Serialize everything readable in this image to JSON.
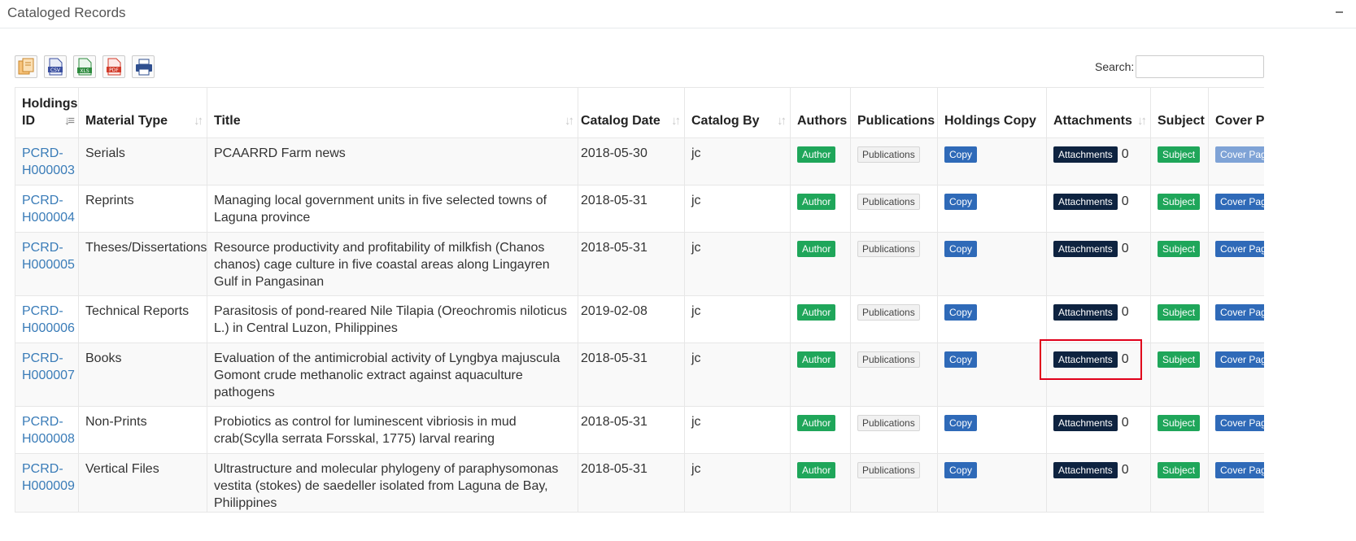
{
  "panel": {
    "title": "Cataloged Records"
  },
  "search": {
    "label": "Search:",
    "value": ""
  },
  "columns": {
    "holdings_id": "Holdings ID",
    "material_type": "Material Type",
    "title": "Title",
    "catalog_date": "Catalog Date",
    "catalog_by": "Catalog By",
    "authors": "Authors",
    "publications": "Publications",
    "holdings_copy": "Holdings Copy",
    "attachments": "Attachments",
    "subject": "Subject",
    "cover_page": "Cover Page"
  },
  "buttons": {
    "author": "Author",
    "publications": "Publications",
    "copy": "Copy",
    "attachments": "Attachments",
    "subject": "Subject",
    "cover_page": "Cover Page"
  },
  "rows": [
    {
      "id": "PCRD-H000003",
      "material_type": "Serials",
      "title": "PCAARRD Farm news",
      "catalog_date": "2018-05-30",
      "catalog_by": "jc",
      "attachments_count": "0"
    },
    {
      "id": "PCRD-H000004",
      "material_type": "Reprints",
      "title": "Managing local government units in five selected towns of Laguna province",
      "catalog_date": "2018-05-31",
      "catalog_by": "jc",
      "attachments_count": "0"
    },
    {
      "id": "PCRD-H000005",
      "material_type": "Theses/Dissertations",
      "title": "Resource productivity and profitability of milkfish (Chanos chanos) cage culture in five coastal areas along Lingayren Gulf in Pangasinan",
      "catalog_date": "2018-05-31",
      "catalog_by": "jc",
      "attachments_count": "0"
    },
    {
      "id": "PCRD-H000006",
      "material_type": "Technical Reports",
      "title": "Parasitosis of pond-reared Nile Tilapia (Oreochromis niloticus L.) in Central Luzon, Philippines",
      "catalog_date": "2019-02-08",
      "catalog_by": "jc",
      "attachments_count": "0"
    },
    {
      "id": "PCRD-H000007",
      "material_type": "Books",
      "title": "Evaluation of the antimicrobial activity of Lyngbya majuscula Gomont crude methanolic extract against aquaculture pathogens",
      "catalog_date": "2018-05-31",
      "catalog_by": "jc",
      "attachments_count": "0"
    },
    {
      "id": "PCRD-H000008",
      "material_type": "Non-Prints",
      "title": "Probiotics as control for luminescent vibriosis in mud crab(Scylla serrata Forsskal, 1775) larval rearing",
      "catalog_date": "2018-05-31",
      "catalog_by": "jc",
      "attachments_count": "0"
    },
    {
      "id": "PCRD-H000009",
      "material_type": "Vertical Files",
      "title": "Ultrastructure and molecular phylogeny of paraphysomonas vestita (stokes) de saedeller isolated from Laguna de Bay, Philippines",
      "catalog_date": "2018-05-31",
      "catalog_by": "jc",
      "attachments_count": "0"
    }
  ],
  "icons": {
    "copy": "copy-icon",
    "csv": "csv-icon",
    "xls": "xls-icon",
    "pdf": "pdf-icon",
    "print": "print-icon",
    "collapse": "minus-icon",
    "sort": "sort-icon"
  },
  "colors": {
    "link": "#3a7cb8",
    "author": "#1fa65a",
    "copy": "#2f6ab8",
    "attachments": "#0e2340",
    "subject": "#1fa65a",
    "cover_page": "#2f6ab8",
    "highlight": "#e0001b"
  }
}
